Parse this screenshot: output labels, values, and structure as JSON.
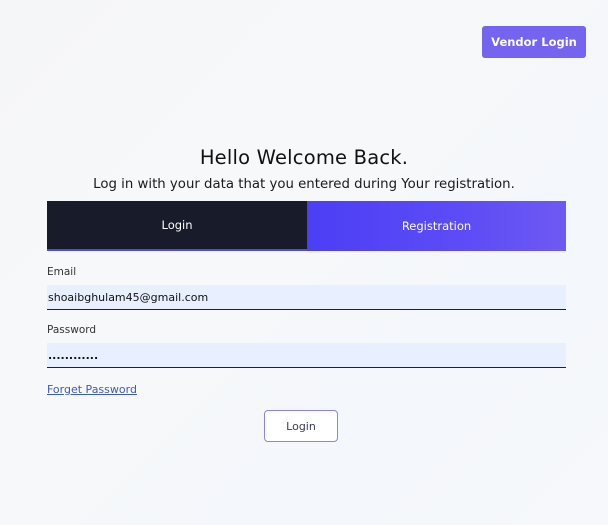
{
  "header": {
    "vendor_login_label": "Vendor Login"
  },
  "main": {
    "title": "Hello Welcome Back.",
    "subtitle": "Log in with your data that you entered during Your registration."
  },
  "tabs": [
    {
      "label": "Login",
      "active": true
    },
    {
      "label": "Registration",
      "active": false
    }
  ],
  "form": {
    "email": {
      "label": "Email",
      "value": "shoaibghulam45@gmail.com"
    },
    "password": {
      "label": "Password",
      "value": "............"
    },
    "forget_password_label": "Forget Password",
    "login_button_label": "Login"
  },
  "colors": {
    "accent": "#7464f0",
    "tab_dark": "#181b2a",
    "tab_active": "#4b3ff5",
    "input_bg": "#e8efff",
    "link": "#3f5bb4"
  }
}
